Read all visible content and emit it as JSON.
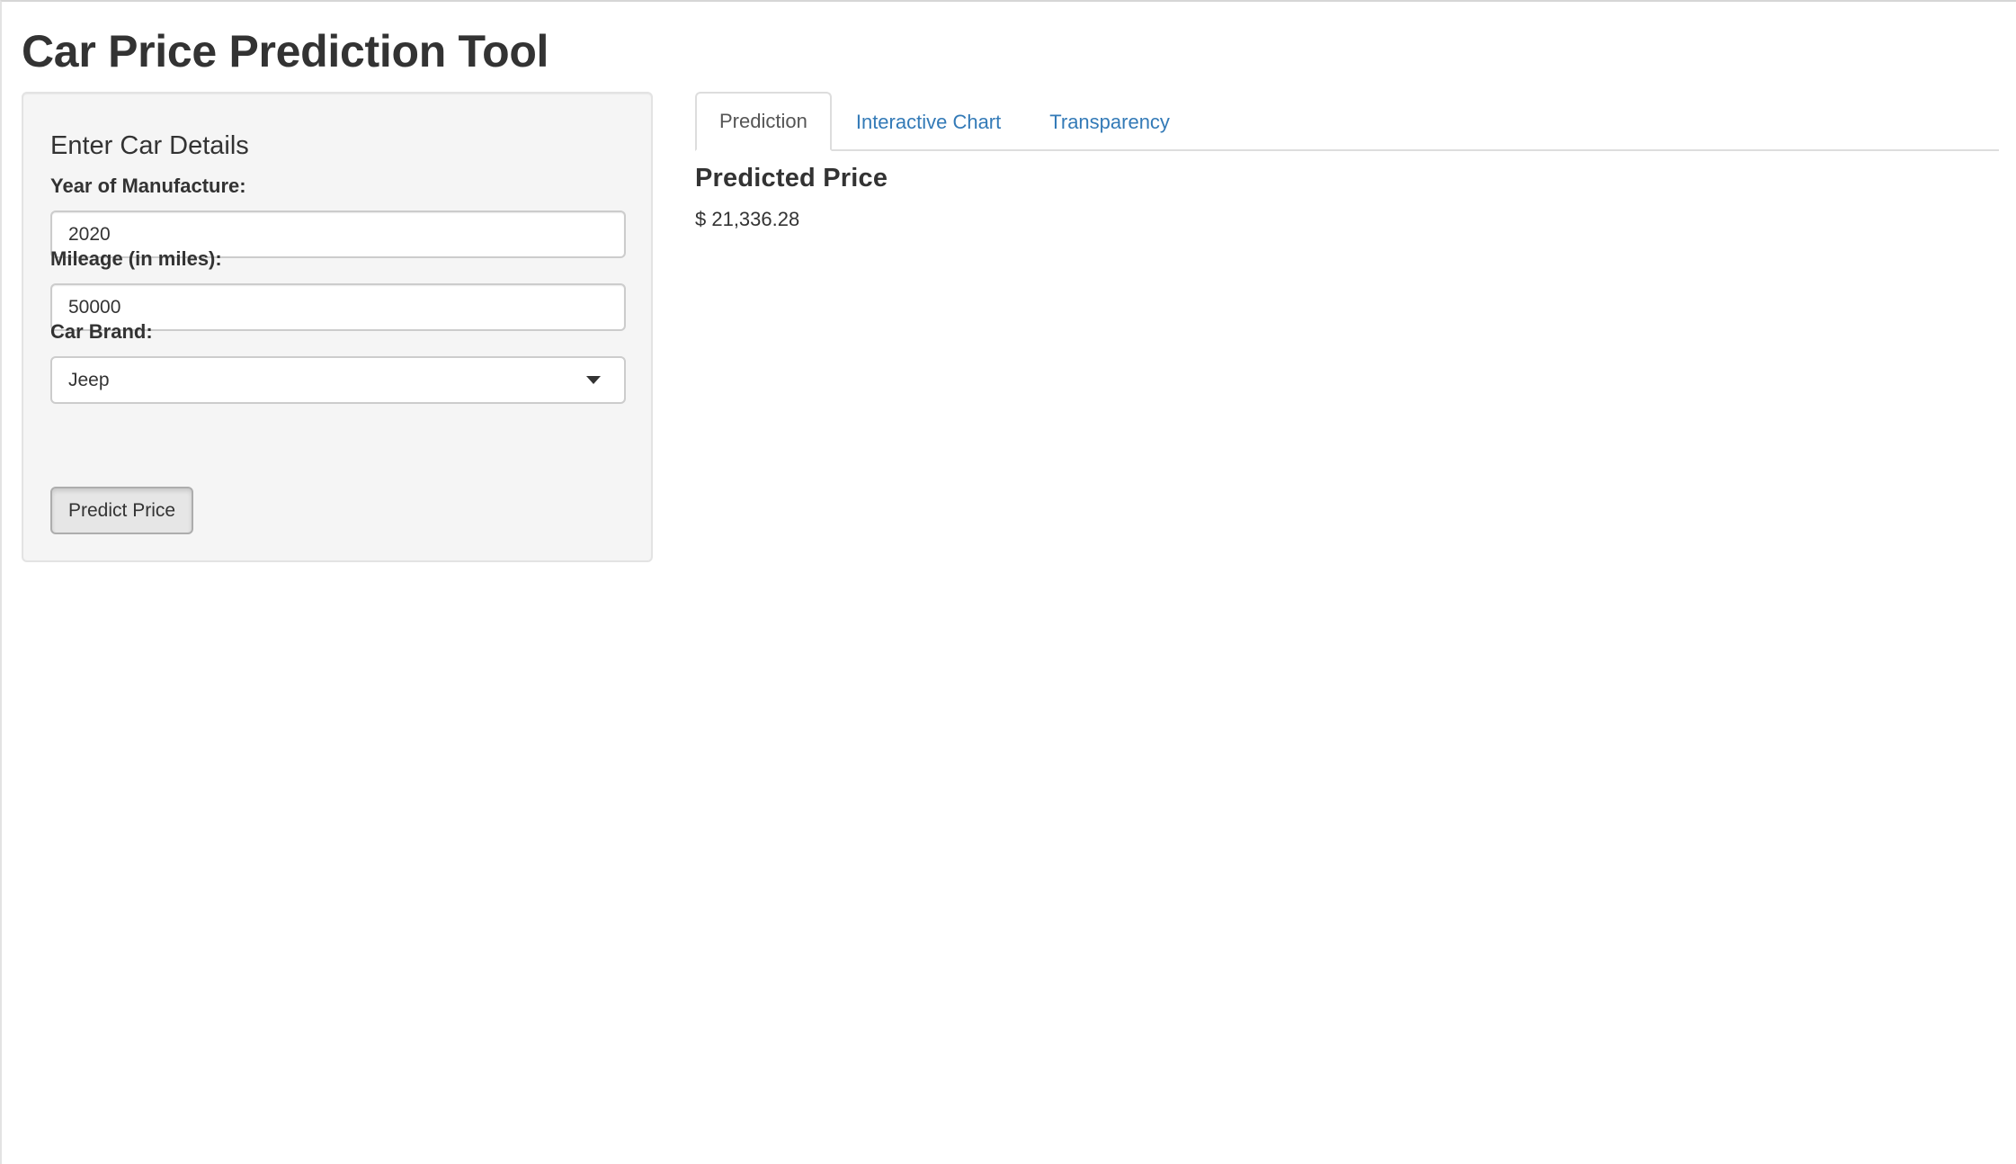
{
  "app": {
    "title": "Car Price Prediction Tool"
  },
  "sidebar": {
    "heading": "Enter Car Details",
    "year": {
      "label": "Year of Manufacture:",
      "value": "2020"
    },
    "mileage": {
      "label": "Mileage (in miles):",
      "value": "50000"
    },
    "brand": {
      "label": "Car Brand:",
      "selected": "Jeep",
      "icon": "chevron-down-icon"
    },
    "predict_button": "Predict Price"
  },
  "main": {
    "tabs": [
      {
        "label": "Prediction",
        "active": true
      },
      {
        "label": "Interactive Chart",
        "active": false
      },
      {
        "label": "Transparency",
        "active": false
      }
    ],
    "result": {
      "heading": "Predicted Price",
      "value": "$ 21,336.28"
    }
  },
  "colors": {
    "link": "#337ab7",
    "panel_background": "#f5f5f5",
    "text": "#333333"
  }
}
